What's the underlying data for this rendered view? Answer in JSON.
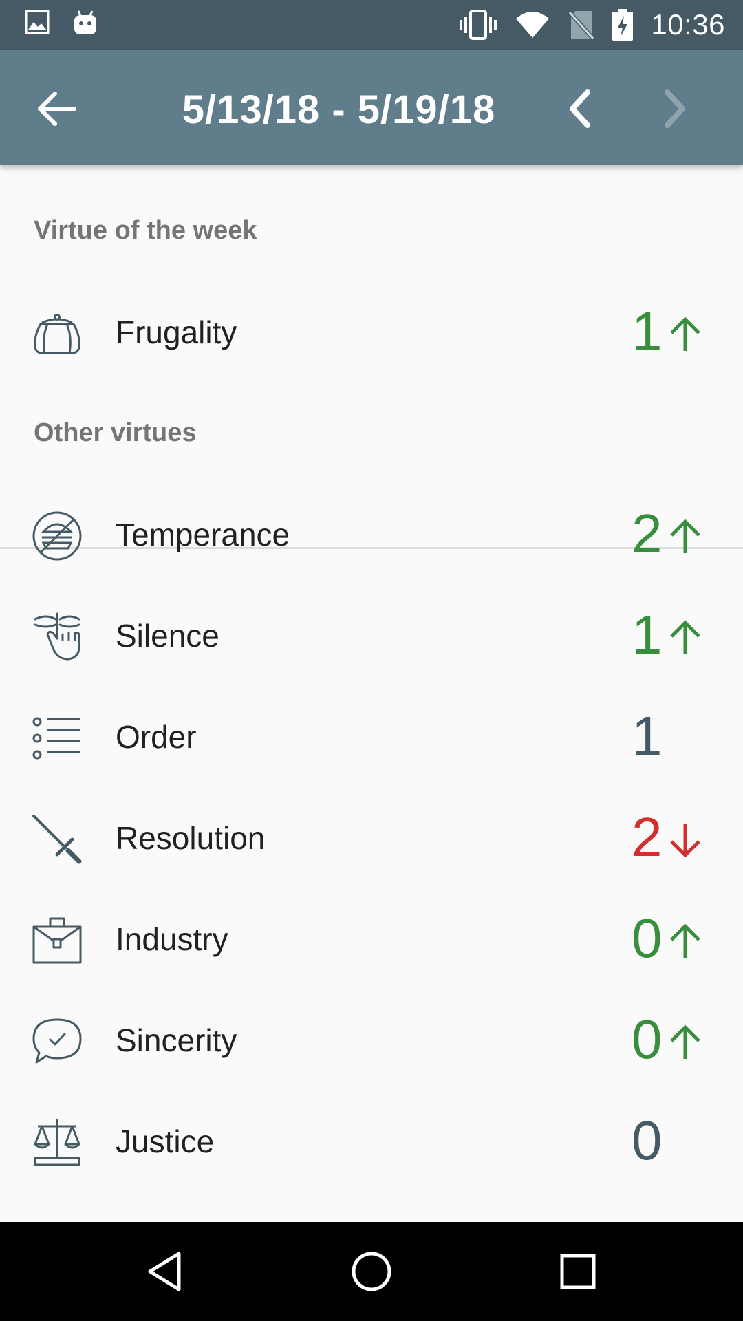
{
  "status_bar": {
    "time": "10:36",
    "left_icons": [
      "gallery-icon",
      "android-icon"
    ],
    "right_icons": [
      "vibrate-icon",
      "wifi-icon",
      "no-sim-icon",
      "battery-charging-icon"
    ]
  },
  "app_bar": {
    "title": "5/13/18 - 5/19/18",
    "back_icon": "arrow-back-icon",
    "prev_icon": "chevron-left-icon",
    "next_icon": "chevron-right-icon"
  },
  "sections": {
    "week_header": "Virtue of the week",
    "other_header": "Other virtues"
  },
  "virtue_of_week": {
    "name": "Frugality",
    "score": "1",
    "trend": "up",
    "icon": "purse-icon"
  },
  "other_virtues": [
    {
      "name": "Temperance",
      "score": "2",
      "trend": "up",
      "icon": "no-food-icon"
    },
    {
      "name": "Silence",
      "score": "1",
      "trend": "up",
      "icon": "hush-hand-icon"
    },
    {
      "name": "Order",
      "score": "1",
      "trend": "none",
      "icon": "list-icon"
    },
    {
      "name": "Resolution",
      "score": "2",
      "trend": "down",
      "icon": "sword-icon"
    },
    {
      "name": "Industry",
      "score": "0",
      "trend": "up",
      "icon": "briefcase-icon"
    },
    {
      "name": "Sincerity",
      "score": "0",
      "trend": "up",
      "icon": "speech-check-icon"
    },
    {
      "name": "Justice",
      "score": "0",
      "trend": "none",
      "icon": "scales-icon"
    }
  ],
  "colors": {
    "status_bar": "#455a64",
    "app_bar": "#607d8b",
    "up": "#388e3c",
    "down": "#d32f2f",
    "neutral": "#455a64",
    "icon_stroke": "#455a64"
  },
  "nav_bar": {
    "icons": [
      "nav-back-icon",
      "nav-home-icon",
      "nav-recents-icon"
    ]
  }
}
